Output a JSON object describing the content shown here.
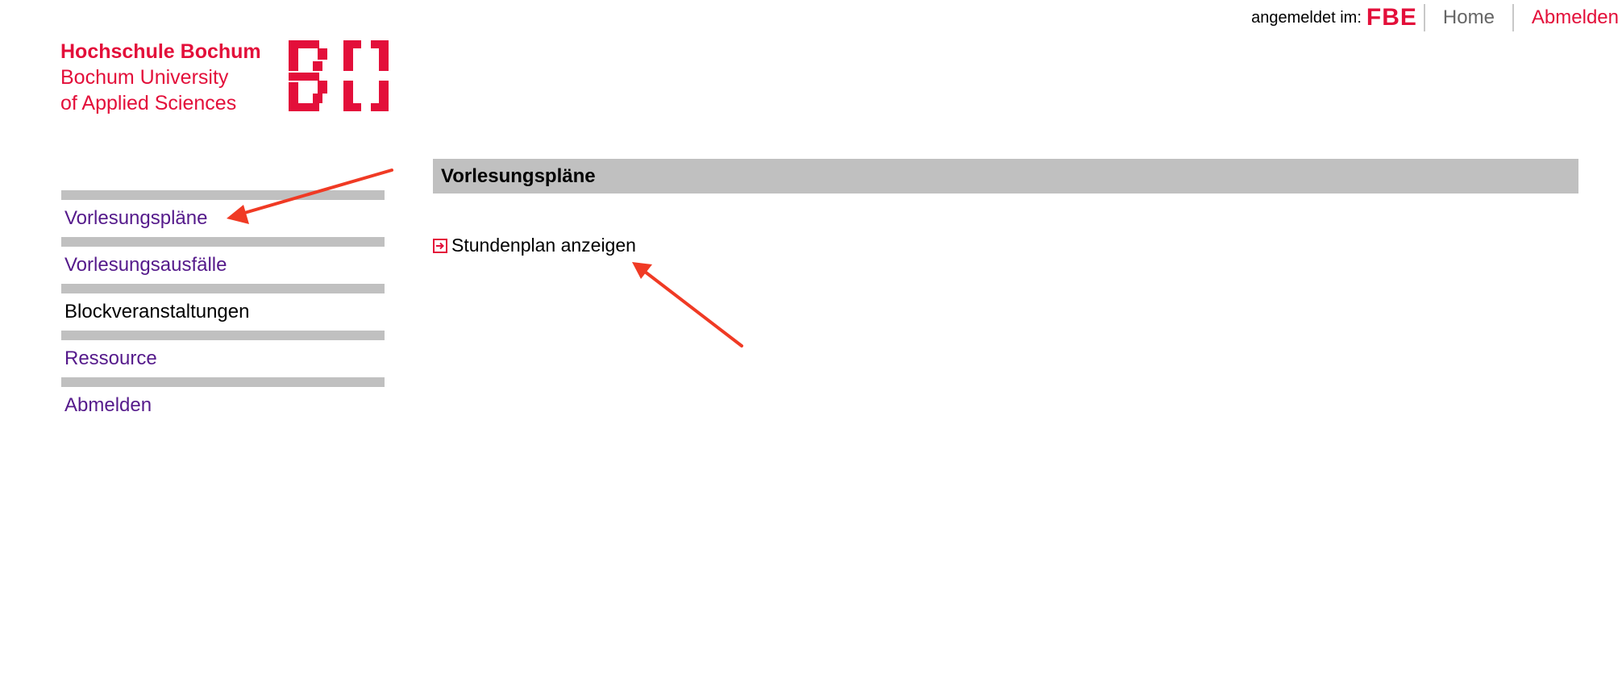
{
  "header": {
    "login_label": "angemeldet im:",
    "faculty": "FBE",
    "home_label": "Home",
    "logout_label": "Abmelden"
  },
  "logo": {
    "line1": "Hochschule Bochum",
    "line2": "Bochum University",
    "line3": "of Applied Sciences",
    "mark": "BO"
  },
  "sidebar": {
    "items": [
      {
        "label": "Vorlesungspläne",
        "state": "visited"
      },
      {
        "label": "Vorlesungsausfälle",
        "state": "visited"
      },
      {
        "label": "Blockveranstaltungen",
        "state": "current"
      },
      {
        "label": "Ressource",
        "state": "visited"
      },
      {
        "label": "Abmelden",
        "state": "visited"
      }
    ]
  },
  "main": {
    "section_title": "Vorlesungspläne",
    "action": {
      "label": "Stundenplan anzeigen",
      "icon": "arrow-in-box-icon"
    }
  },
  "colors": {
    "brand_red": "#e30f3a",
    "visited_link": "#551a8b",
    "bar_gray": "#c0c0c0",
    "annotation_arrow": "#f03a24"
  }
}
